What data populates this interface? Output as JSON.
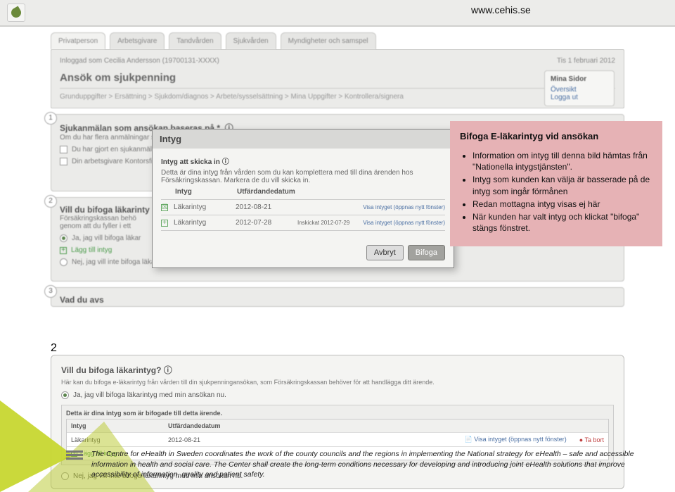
{
  "url": "www.cehis.se",
  "tabs": [
    "Privatperson",
    "Arbetsgivare",
    "Tandvården",
    "Sjukvården",
    "Myndigheter och samspel"
  ],
  "header": {
    "logged_as": "Inloggad som Cecilia Andersson (19700131-XXXX)",
    "date": "Tis 1 februari 2012",
    "title": "Ansök om sjukpenning",
    "breadcrumb": "Grunduppgifter > Ersättning > Sjukdom/diagnos > Arbete/sysselsättning > Mina Uppgifter > Kontrollera/signera"
  },
  "mina_sidor": {
    "title": "Mina Sidor",
    "items": [
      "Översikt",
      "Logga ut"
    ]
  },
  "section1": {
    "title": "Sjukanmälan som ansökan baseras på *",
    "sub": "Om du har flera anmälningar sk",
    "opt1": "Du har gjort en sjukanmälan",
    "opt2": "Din arbetsgivare Kontorsfix A"
  },
  "section2": {
    "title": "Vill du bifoga läkarinty",
    "sub1": "Försäkringskassan behö",
    "sub2": "genom att du fyller i ett",
    "opt_yes": "Ja, jag vill bifoga läkar",
    "add": "Lägg till intyg",
    "opt_no": "Nej, jag vill inte bifoga läka"
  },
  "section3": {
    "title": "Vad du avs"
  },
  "modal": {
    "title": "Intyg",
    "subtitle": "Intyg att skicka in",
    "desc": "Detta är dina intyg från vården som du kan komplettera med till dina ärenden hos Försäkringskassan. Markera de du vill skicka in.",
    "thead": [
      "Intyg",
      "Utfärdandedatum"
    ],
    "rows": [
      {
        "name": "Läkarintyg",
        "date": "2012-08-21",
        "note": "Visa intyget (öppnas nytt fönster)",
        "checked": true
      },
      {
        "name": "Läkarintyg",
        "date": "2012-07-28",
        "extra": "Inskickat 2012-07-29",
        "note": "Visa intyget (öppnas nytt fönster)"
      }
    ],
    "btn_cancel": "Avbryt",
    "btn_ok": "Bifoga"
  },
  "callout": {
    "title": "Bifoga E-läkarintyg vid ansökan",
    "items": [
      "Information om intyg till denna bild hämtas från \"Nationella intygstjänsten\".",
      "Intyg som kunden kan välja är basserade på de intyg som ingår förmånen",
      "Redan mottagna intyg visas ej här",
      "När kunden har valt intyg och klickat \"bifoga\" stängs  fönstret."
    ]
  },
  "lower": {
    "title": "Vill du bifoga läkarintyg?",
    "desc": "Här kan du bifoga e-läkarintyg från vården till din sjukpenningansökan, som Försäkringskassan behöver för att handlägga ditt ärende.",
    "opt_yes": "Ja, jag vill bifoga läkarintyg med min ansökan nu.",
    "box_title": "Detta är dina intyg som är bifogade till detta ärende.",
    "thead": [
      "Intyg",
      "Utfärdandedatum"
    ],
    "row": {
      "name": "Läkarintyg",
      "date": "2012-08-21",
      "view": "Visa intyget (öppnas nytt fönster)",
      "remove": "Ta bort"
    },
    "add": "Lägg till intyg",
    "opt_no": "Nej, jag vill inte bifoga läkarintyg med min ansökan nu."
  },
  "footer": "The Centre for eHealth in Sweden coordinates the work of the county councils and the regions in implementing the National strategy for eHealth – safe and accessible information in health and social care. The Center shall create the long-term conditions necessary for developing and introducing joint eHealth solutions that improve accessibility of information, quality and patient safety."
}
